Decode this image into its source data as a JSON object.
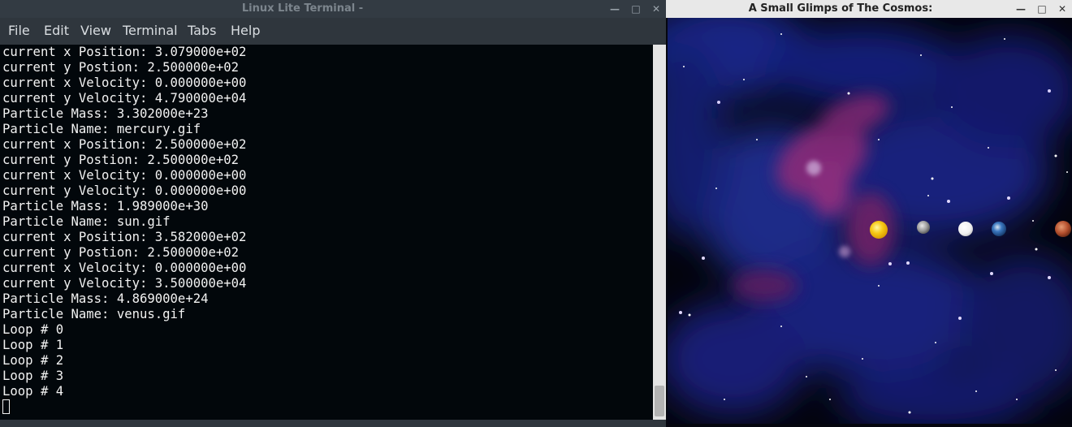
{
  "terminal": {
    "title": "Linux Lite Terminal -",
    "window_controls": {
      "minimize": "—",
      "maximize": "□",
      "close": "✕"
    },
    "menu": [
      "File",
      "Edit",
      "View",
      "Terminal",
      "Tabs",
      "Help"
    ],
    "lines": [
      "current x Position: 3.079000e+02",
      "current y Postion: 2.500000e+02",
      "current x Velocity: 0.000000e+00",
      "current y Velocity: 4.790000e+04",
      "Particle Mass: 3.302000e+23",
      "Particle Name: mercury.gif",
      "current x Position: 2.500000e+02",
      "current y Postion: 2.500000e+02",
      "current x Velocity: 0.000000e+00",
      "current y Velocity: 0.000000e+00",
      "Particle Mass: 1.989000e+30",
      "Particle Name: sun.gif",
      "current x Position: 3.582000e+02",
      "current y Postion: 2.500000e+02",
      "current x Velocity: 0.000000e+00",
      "current y Velocity: 3.500000e+04",
      "Particle Mass: 4.869000e+24",
      "Particle Name: venus.gif",
      "Loop # 0",
      "Loop # 1",
      "Loop # 2",
      "Loop # 3",
      "Loop # 4"
    ]
  },
  "cosmos": {
    "title": "A Small Glimps of The Cosmos:",
    "window_controls": {
      "minimize": "—",
      "maximize": "□",
      "close": "✕"
    },
    "bodies": [
      {
        "name": "sun",
        "color": "#f5c518",
        "glow": "#ffe14a"
      },
      {
        "name": "mercury",
        "color": "#9c9c9c",
        "glow": "#d8d8d8"
      },
      {
        "name": "venus",
        "color": "#f4f4f4",
        "glow": "#ffffff"
      },
      {
        "name": "earth",
        "color": "#2f6db5",
        "glow": "#e8eef5"
      },
      {
        "name": "mars",
        "color": "#b5502e",
        "glow": "#e08860"
      }
    ]
  }
}
